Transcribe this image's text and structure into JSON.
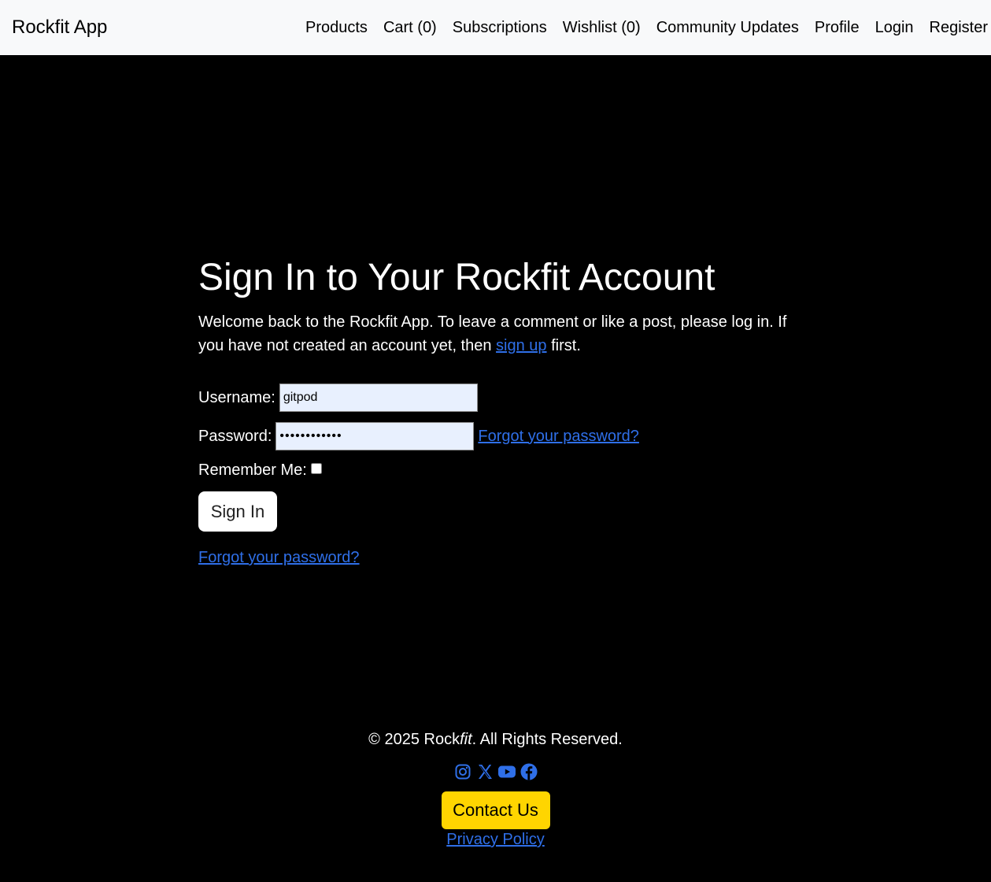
{
  "navbar": {
    "brand": "Rockfit App",
    "links": [
      {
        "label": "Products"
      },
      {
        "label": "Cart (0)"
      },
      {
        "label": "Subscriptions"
      },
      {
        "label": "Wishlist (0)"
      },
      {
        "label": "Community Updates"
      },
      {
        "label": "Profile"
      },
      {
        "label": "Login"
      },
      {
        "label": "Register"
      }
    ]
  },
  "main": {
    "title": "Sign In to Your Rockfit Account",
    "intro_before": "Welcome back to the Rockfit App. To leave a comment or like a post, please log in. If you have not created an account yet, then ",
    "intro_link": "sign up",
    "intro_after": " first.",
    "form": {
      "username_label": "Username:",
      "username_value": "gitpod",
      "password_label": "Password:",
      "password_value": "••••••••••••",
      "forgot_inline": "Forgot your password?",
      "remember_label": "Remember Me:",
      "remember_checked": false,
      "submit_label": "Sign In"
    },
    "forgot_bottom": "Forgot your password?"
  },
  "footer": {
    "copyright_prefix": "© 2025 Rock",
    "copyright_italic": "fit",
    "copyright_suffix": ". All Rights Reserved.",
    "socials": [
      {
        "icon": "instagram-icon"
      },
      {
        "icon": "x-twitter-icon"
      },
      {
        "icon": "youtube-icon"
      },
      {
        "icon": "facebook-icon"
      }
    ],
    "contact_label": "Contact Us",
    "privacy_label": "Privacy Policy"
  },
  "colors": {
    "navbar_bg": "#f8f9fa",
    "page_bg": "#000000",
    "link": "#2f6fe8",
    "contact_button": "#ffd500",
    "input_bg": "#e8f0fe"
  }
}
